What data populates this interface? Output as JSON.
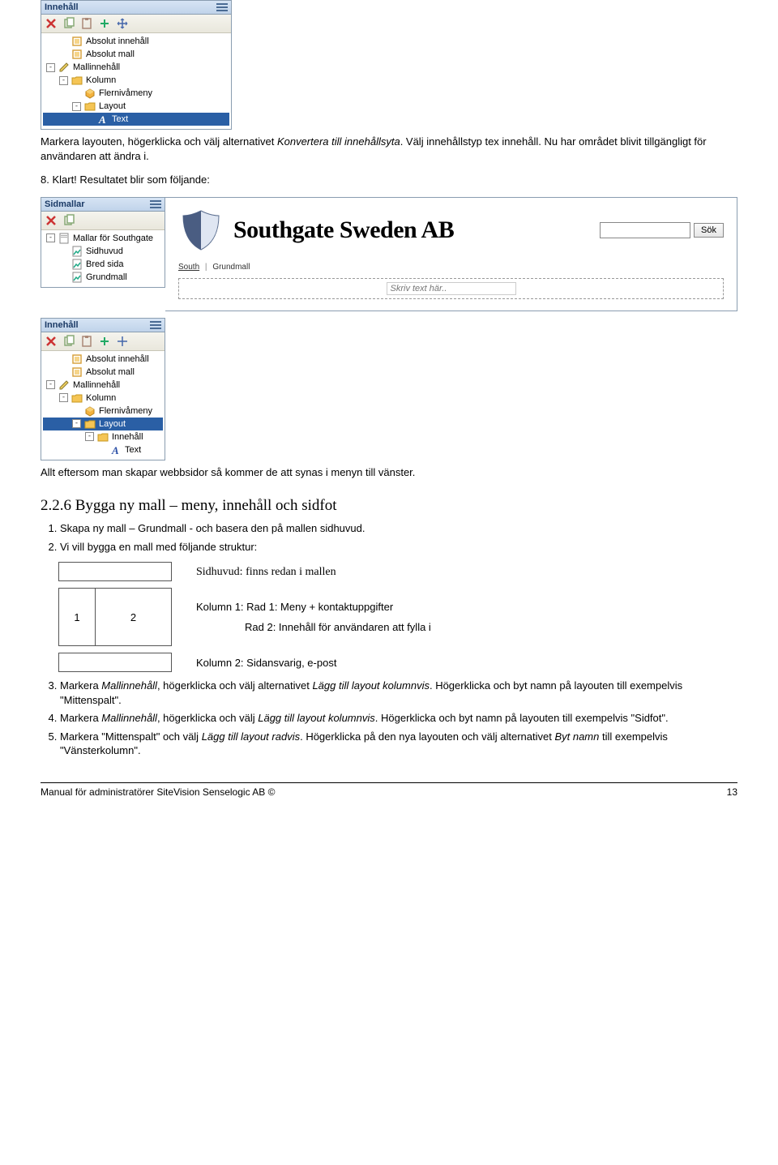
{
  "panel_innehall": {
    "title": "Innehåll",
    "items": [
      {
        "indent": 1,
        "exp": "",
        "icon": "box-icon",
        "label": "Absolut innehåll",
        "sel": false
      },
      {
        "indent": 1,
        "exp": "",
        "icon": "box-icon",
        "label": "Absolut mall",
        "sel": false
      },
      {
        "indent": 0,
        "exp": "-",
        "icon": "pencil-icon",
        "label": "Mallinnehåll",
        "sel": false
      },
      {
        "indent": 1,
        "exp": "-",
        "icon": "folder-icon",
        "label": "Kolumn",
        "sel": false
      },
      {
        "indent": 2,
        "exp": "",
        "icon": "cube-icon",
        "label": "Flernivåmeny",
        "sel": false
      },
      {
        "indent": 2,
        "exp": "-",
        "icon": "folder-icon",
        "label": "Layout",
        "sel": false
      },
      {
        "indent": 3,
        "exp": "",
        "icon": "text-a-icon",
        "label": "Text",
        "sel": true
      }
    ]
  },
  "para1_a": "Markera layouten, högerklicka och välj alternativet ",
  "para1_b": "Konvertera till innehållsyta",
  "para1_c": ". Välj innehållstyp tex innehåll. Nu har området blivit tillgängligt för användaren att ändra i.",
  "para2": "8. Klart! Resultatet blir som följande:",
  "panel_sidmallar": {
    "title": "Sidmallar",
    "items": [
      {
        "indent": 0,
        "exp": "-",
        "icon": "page-icon",
        "label": "Mallar för Southgate"
      },
      {
        "indent": 1,
        "exp": "",
        "icon": "page-green-icon",
        "label": "Sidhuvud"
      },
      {
        "indent": 1,
        "exp": "",
        "icon": "page-green-icon",
        "label": "Bred sida"
      },
      {
        "indent": 1,
        "exp": "",
        "icon": "page-green-icon",
        "label": "Grundmall"
      }
    ]
  },
  "preview": {
    "title": "Southgate Sweden AB",
    "search_button": "Sök",
    "breadcrumb1": "South",
    "breadcrumb2": "Grundmall",
    "placeholder": "Skriv text här.."
  },
  "panel_innehall2": {
    "title": "Innehåll",
    "items": [
      {
        "indent": 1,
        "exp": "",
        "icon": "box-icon",
        "label": "Absolut innehåll",
        "sel": false
      },
      {
        "indent": 1,
        "exp": "",
        "icon": "box-icon",
        "label": "Absolut mall",
        "sel": false
      },
      {
        "indent": 0,
        "exp": "-",
        "icon": "pencil-icon",
        "label": "Mallinnehåll",
        "sel": false
      },
      {
        "indent": 1,
        "exp": "-",
        "icon": "folder-icon",
        "label": "Kolumn",
        "sel": false
      },
      {
        "indent": 2,
        "exp": "",
        "icon": "cube-icon",
        "label": "Flernivåmeny",
        "sel": false
      },
      {
        "indent": 2,
        "exp": "-",
        "icon": "folder-icon",
        "label": "Layout",
        "sel": true
      },
      {
        "indent": 3,
        "exp": "-",
        "icon": "folder-icon",
        "label": "Innehåll",
        "sel": false
      },
      {
        "indent": 4,
        "exp": "",
        "icon": "text-a-icon",
        "label": "Text",
        "sel": false
      }
    ]
  },
  "para3": "Allt eftersom man  skapar webbsidor så kommer de att synas i menyn till vänster.",
  "section_title": "2.2.6 Bygga ny mall – meny, innehåll och sidfot",
  "li1": "Skapa ny mall – Grundmall - och basera den på mallen sidhuvud.",
  "li2": "Vi vill bygga en mall med följande struktur:",
  "schematic": {
    "sidhuvud": "Sidhuvud: finns redan i mallen",
    "col1": "1",
    "col2": "2",
    "k1r1": "Kolumn 1: Rad 1: Meny + kontaktuppgifter",
    "k1r2": "Rad 2: Innehåll för användaren att fylla i",
    "k2": "Kolumn 2: Sidansvarig, e-post"
  },
  "li3_a": "Markera ",
  "li3_b": "Mallinnehåll",
  "li3_c": ", högerklicka och välj alternativet ",
  "li3_d": "Lägg till layout kolumnvis",
  "li3_e": ". Högerklicka och byt namn på layouten till exempelvis \"Mittenspalt\".",
  "li4_a": "Markera ",
  "li4_b": "Mallinnehåll",
  "li4_c": ", högerklicka och välj ",
  "li4_d": "Lägg till layout kolumnvis",
  "li4_e": ". Högerklicka och byt namn på layouten till exempelvis \"Sidfot\".",
  "li5_a": "Markera \"Mittenspalt\" och välj ",
  "li5_b": "Lägg till layout radvis",
  "li5_c": ". Högerklicka på den nya layouten och välj alternativet ",
  "li5_d": "Byt namn",
  "li5_e": " till exempelvis \"Vänsterkolumn\".",
  "footer_left": "Manual för administratörer SiteVision Senselogic AB ©",
  "footer_right": "13"
}
